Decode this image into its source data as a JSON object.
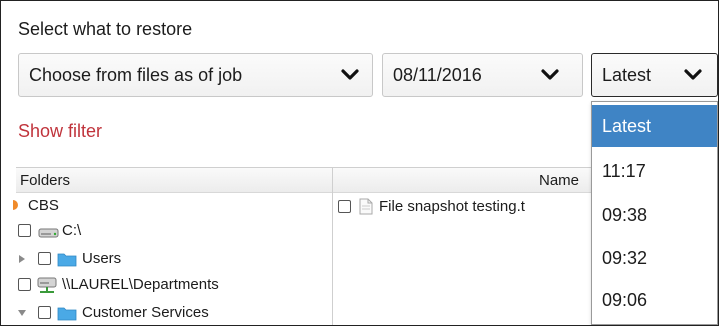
{
  "title": "Select what to restore",
  "selects": {
    "mode": "Choose from files as of job",
    "date": "08/11/2016",
    "time": "Latest"
  },
  "show_filter": "Show filter",
  "columns": {
    "folders": "Folders",
    "name": "Name"
  },
  "tree": {
    "root": "CBS",
    "drive": "C:\\",
    "users": "Users",
    "network_share": "\\\\LAUREL\\Departments",
    "customer_services": "Customer Services"
  },
  "files": [
    {
      "name": "File snapshot testing.t"
    }
  ],
  "time_options": [
    "Latest",
    "11:17",
    "09:38",
    "09:32",
    "09:06"
  ],
  "colors": {
    "accent_selected": "#3f84c5",
    "link_red": "#c0343c",
    "folder_blue": "#4aa9e6"
  }
}
